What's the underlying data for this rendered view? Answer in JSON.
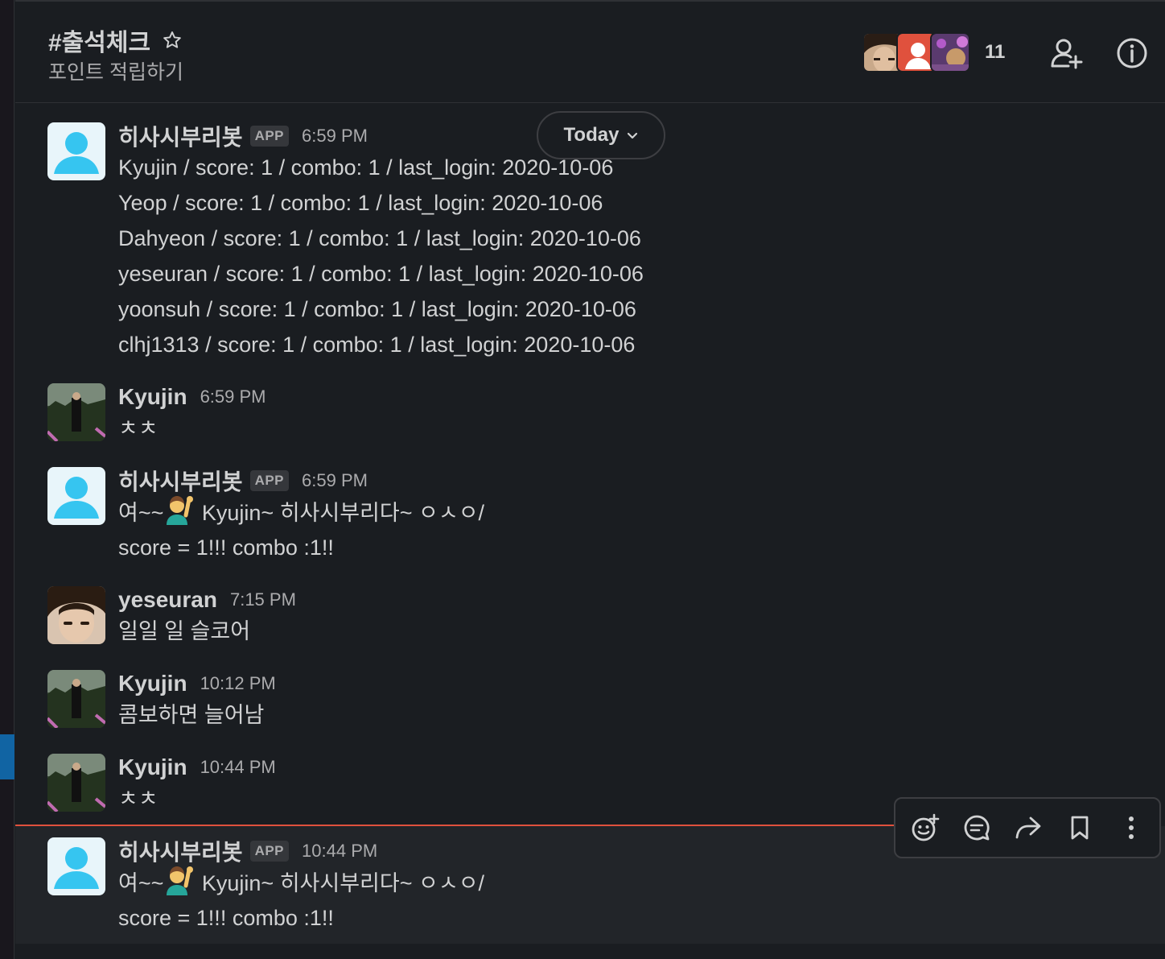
{
  "channel": {
    "name": "#출석체크",
    "topic": "포인트 적립하기",
    "member_count": "11"
  },
  "date_divider": {
    "label": "Today"
  },
  "messages": [
    {
      "author": "히사시부리봇",
      "badge": "APP",
      "time": "6:59 PM",
      "avatar": "default-user-avatar",
      "lines": [
        "Kyujin / score: 1 / combo: 1 / last_login: 2020-10-06",
        "Yeop / score: 1 / combo: 1 / last_login: 2020-10-06",
        "Dahyeon / score: 1 / combo: 1 / last_login: 2020-10-06",
        "yeseuran / score: 1 / combo: 1 / last_login: 2020-10-06",
        "yoonsuh / score: 1 / combo: 1 / last_login: 2020-10-06",
        "clhj1313 / score: 1 / combo: 1 / last_login: 2020-10-06"
      ]
    },
    {
      "author": "Kyujin",
      "time": "6:59 PM",
      "avatar": "photo-avatar-kyujin",
      "lines": [
        "ㅊㅊ"
      ]
    },
    {
      "author": "히사시부리봇",
      "badge": "APP",
      "time": "6:59 PM",
      "avatar": "default-user-avatar",
      "line1_prefix": "여~~",
      "line1_suffix": " Kyujin~ 히사시부리다~ ㅇㅅㅇ/",
      "line2": "score = 1!!! combo :1!!"
    },
    {
      "author": "yeseuran",
      "time": "7:15 PM",
      "avatar": "photo-avatar-yeseuran",
      "lines": [
        "일일 일 슬코어"
      ]
    },
    {
      "author": "Kyujin",
      "time": "10:12 PM",
      "avatar": "photo-avatar-kyujin",
      "lines": [
        "콤보하면 늘어남"
      ]
    },
    {
      "author": "Kyujin",
      "time": "10:44 PM",
      "avatar": "photo-avatar-kyujin",
      "lines": [
        "ㅊㅊ"
      ]
    },
    {
      "author": "히사시부리봇",
      "badge": "APP",
      "time": "10:44 PM",
      "avatar": "default-user-avatar",
      "line1_prefix": "여~~",
      "line1_suffix": " Kyujin~ 히사시부리다~ ㅇㅅㅇ/",
      "line2": "score = 1!!! combo :1!!"
    }
  ],
  "colors": {
    "background": "#1a1d21",
    "accent_new": "#e0513d",
    "sidebar_selected": "#1164a3",
    "default_avatar_bg": "#e8f5fa",
    "default_avatar_fg": "#36c5f0"
  }
}
